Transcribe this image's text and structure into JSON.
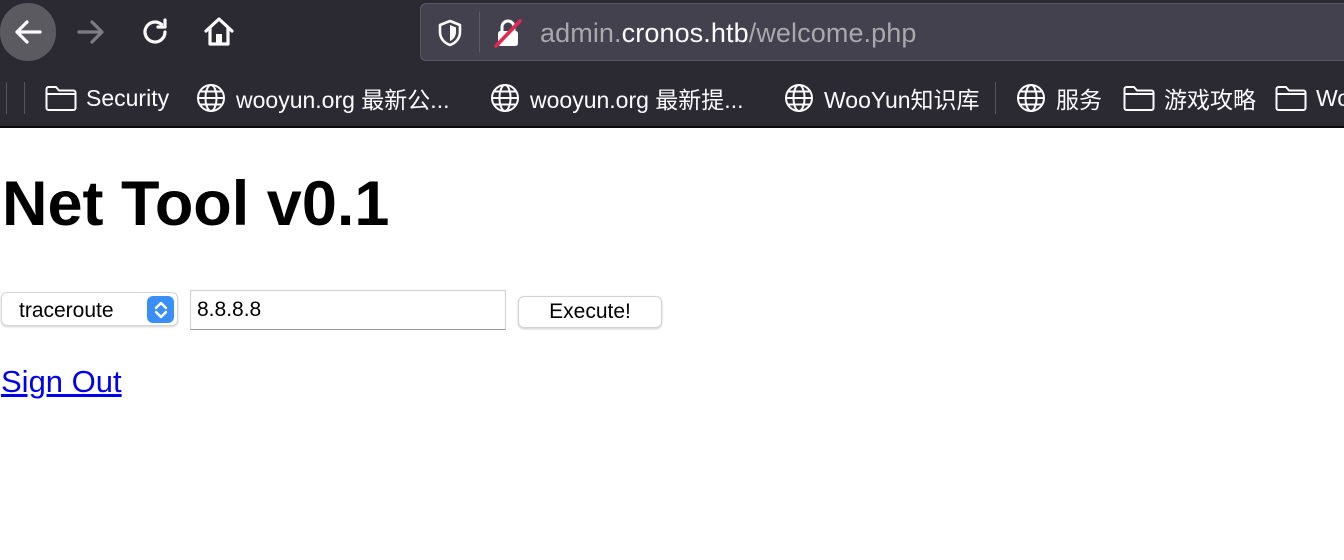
{
  "browser": {
    "url": {
      "prefix": "admin.",
      "host": "cronos.htb",
      "path": "/welcome.php"
    },
    "bookmarks": [
      {
        "label": "Security",
        "icon": "folder-icon"
      },
      {
        "label": "wooyun.org 最新公...",
        "icon": "globe-icon"
      },
      {
        "label": "wooyun.org 最新提...",
        "icon": "globe-icon"
      },
      {
        "label": "WooYun知识库",
        "icon": "globe-icon"
      },
      {
        "label": "服务",
        "icon": "globe-icon"
      },
      {
        "label": "游戏攻略",
        "icon": "folder-icon"
      },
      {
        "label": "Wo",
        "icon": "folder-icon"
      }
    ]
  },
  "page": {
    "title": "Net Tool v0.1",
    "command_select": {
      "value": "traceroute"
    },
    "host_input": {
      "value": "8.8.8.8"
    },
    "execute_label": "Execute!",
    "signout_label": "Sign Out"
  },
  "colors": {
    "chrome_bg": "#2b2a33",
    "urlbar_bg": "#42414d",
    "link": "#0000ee",
    "select_accent": "#3a8ff7"
  }
}
